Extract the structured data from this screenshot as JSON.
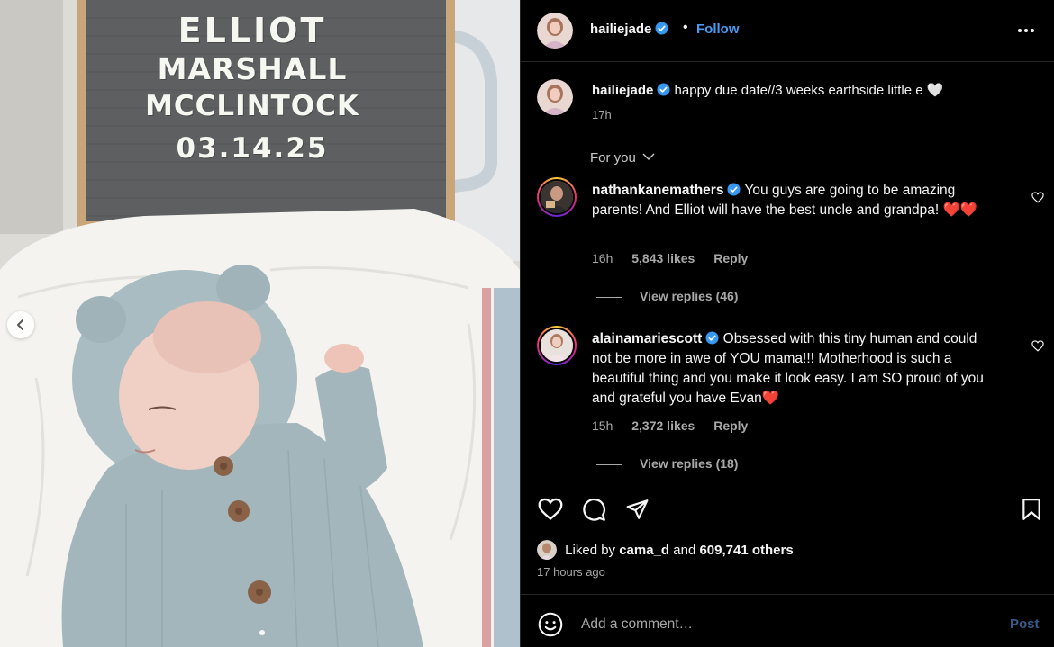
{
  "post_image": {
    "letterboard_lines": [
      "ELLIOT",
      "MARSHALL",
      "MCCLINTOCK",
      "03.14.25"
    ]
  },
  "header": {
    "username": "hailiejade",
    "separator": "•",
    "follow_label": "Follow"
  },
  "caption": {
    "username": "hailiejade",
    "text": "happy due date//3 weeks earthside little e 🤍",
    "time": "17h"
  },
  "comments_filter": {
    "label": "For you"
  },
  "comments": [
    {
      "username": "nathankanemathers",
      "text": "You guys are going to be amazing parents! And Elliot will have the best uncle and grandpa! ❤️❤️",
      "time": "16h",
      "likes": "5,843 likes",
      "reply_label": "Reply",
      "view_replies": "View replies (46)"
    },
    {
      "username": "alainamariescott",
      "text": "Obsessed with this tiny human and could not be more in awe of YOU mama!!! Motherhood is such a beautiful thing and you make it look easy. I am SO proud of you and grateful you have Evan❤️",
      "time": "15h",
      "likes": "2,372 likes",
      "reply_label": "Reply",
      "view_replies": "View replies (18)"
    }
  ],
  "likes": {
    "prefix": "Liked by",
    "user": "cama_d",
    "joiner": "and",
    "others": "609,741 others",
    "time_ago": "17 hours ago"
  },
  "composer": {
    "placeholder": "Add a comment…",
    "post_label": "Post"
  },
  "colors": {
    "background": "#000000",
    "link_blue": "#4a9bf0",
    "muted_text": "#a8a8a8",
    "post_disabled": "#395a87",
    "verified_blue": "#3897f0"
  },
  "icons": [
    "chevron-left-icon",
    "more-icon",
    "verified-icon",
    "chevron-down-icon",
    "heart-icon",
    "comment-icon",
    "share-icon",
    "bookmark-icon",
    "emoji-icon"
  ]
}
